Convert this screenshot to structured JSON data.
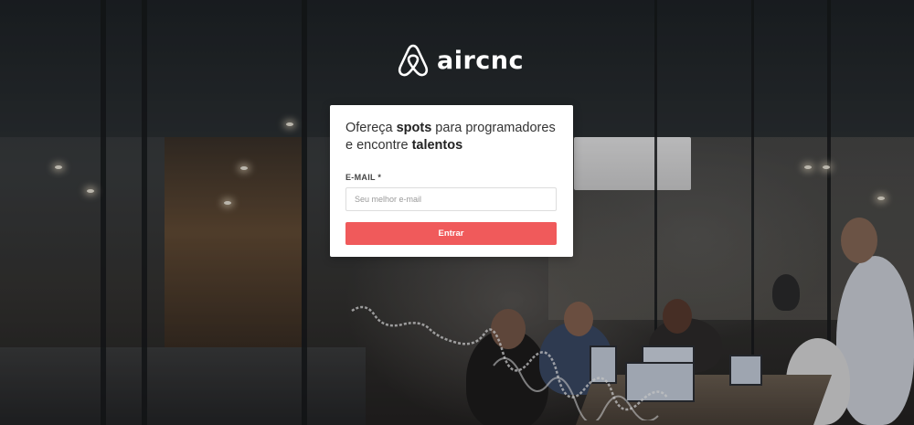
{
  "brand": {
    "name": "aircnc",
    "logo_icon": "airbnb-belo-icon",
    "accent_color": "#f05a5b"
  },
  "login": {
    "headline": {
      "part1": "Ofereça ",
      "bold1": "spots",
      "part2": " para programadores e encontre ",
      "bold2": "talentos"
    },
    "email_label": "E-MAIL *",
    "email_placeholder": "Seu melhor e-mail",
    "email_value": "",
    "submit_label": "Entrar"
  }
}
